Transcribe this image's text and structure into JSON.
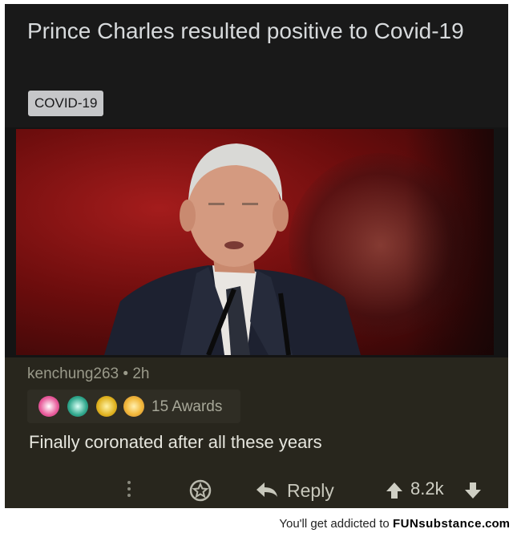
{
  "post": {
    "title": "Prince Charles resulted positive to Covid-19",
    "flair": "COVID-19"
  },
  "comment": {
    "username": "kenchung263",
    "separator": "•",
    "age": "2h",
    "awards_label": "15 Awards",
    "body": "Finally coronated after all these years",
    "reply_label": "Reply",
    "score": "8.2k",
    "award_icons": [
      "crown-award-icon",
      "globe-award-icon",
      "gold-star-award-icon",
      "clapping-hands-award-icon"
    ]
  },
  "watermark": {
    "prefix": "You'll get addicted to",
    "brand": "FUNsubstance",
    "tld": ".com"
  },
  "colors": {
    "post_bg": "#191919",
    "comment_bg": "#28261d",
    "flair_bg": "#c6c7c9"
  }
}
